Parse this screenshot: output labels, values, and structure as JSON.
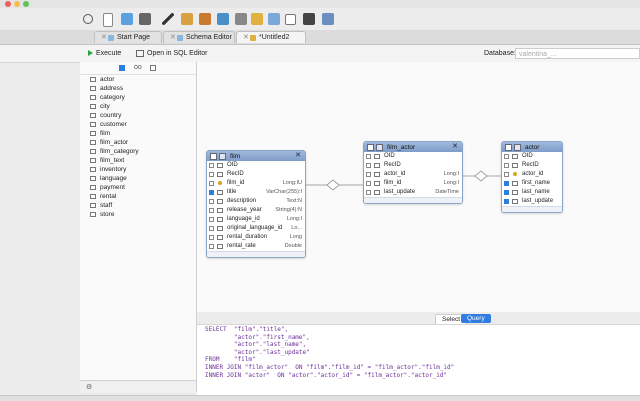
{
  "tabs": [
    {
      "label": "Start Page"
    },
    {
      "label": "Schema Editor"
    },
    {
      "label": "*Untitled2"
    }
  ],
  "actions": {
    "execute": "Execute",
    "open_sql": "Open in SQL Editor",
    "database_label": "Database:",
    "database_value": "valentina_..."
  },
  "sidebar": {
    "tables": [
      "actor",
      "address",
      "category",
      "city",
      "country",
      "customer",
      "film",
      "film_actor",
      "film_category",
      "film_text",
      "inventory",
      "language",
      "payment",
      "rental",
      "staff",
      "store"
    ]
  },
  "entities": {
    "film": {
      "title": "film",
      "close": "✕",
      "fields": [
        {
          "name": "OID",
          "type": "",
          "checked": false,
          "icon": "grid"
        },
        {
          "name": "RecID",
          "type": "",
          "checked": false,
          "icon": "grid"
        },
        {
          "name": "film_id",
          "type": "Long:IU",
          "checked": false,
          "icon": "key"
        },
        {
          "name": "title",
          "type": "VarChar(255):I",
          "checked": true,
          "icon": "col"
        },
        {
          "name": "description",
          "type": "Text:N",
          "checked": false,
          "icon": "col"
        },
        {
          "name": "release_year",
          "type": "String(4):N",
          "checked": false,
          "icon": "col"
        },
        {
          "name": "language_id",
          "type": "Long:I",
          "checked": false,
          "icon": "col"
        },
        {
          "name": "original_language_id",
          "type": "Lo...",
          "checked": false,
          "icon": "col"
        },
        {
          "name": "rental_duration",
          "type": "Long",
          "checked": false,
          "icon": "col"
        },
        {
          "name": "rental_rate",
          "type": "Double",
          "checked": false,
          "icon": "col"
        }
      ]
    },
    "film_actor": {
      "title": "film_actor",
      "close": "✕",
      "fields": [
        {
          "name": "OID",
          "type": "",
          "checked": false,
          "icon": "grid"
        },
        {
          "name": "RecID",
          "type": "",
          "checked": false,
          "icon": "grid"
        },
        {
          "name": "actor_id",
          "type": "Long:I",
          "checked": false,
          "icon": "col"
        },
        {
          "name": "film_id",
          "type": "Long:I",
          "checked": false,
          "icon": "col"
        },
        {
          "name": "last_update",
          "type": "DateTime",
          "checked": false,
          "icon": "col"
        }
      ]
    },
    "actor": {
      "title": "actor",
      "close": "",
      "fields": [
        {
          "name": "OID",
          "type": "",
          "checked": false,
          "icon": "grid"
        },
        {
          "name": "RecID",
          "type": "",
          "checked": false,
          "icon": "grid"
        },
        {
          "name": "actor_id",
          "type": "",
          "checked": false,
          "icon": "key"
        },
        {
          "name": "first_name",
          "type": "",
          "checked": true,
          "icon": "col"
        },
        {
          "name": "last_name",
          "type": "",
          "checked": true,
          "icon": "col"
        },
        {
          "name": "last_update",
          "type": "",
          "checked": true,
          "icon": "col"
        }
      ]
    }
  },
  "query_tabs": {
    "select": "Select",
    "query": "Query"
  },
  "sql_text": "SELECT  \"film\".\"title\",\n        \"actor\".\"first_name\",\n        \"actor\".\"last_name\",\n        \"actor\".\"last_update\"\nFROM    \"film\"\nINNER JOIN \"film_actor\"  ON \"film\".\"film_id\" = \"film_actor\".\"film_id\"\nINNER JOIN \"actor\"  ON \"actor\".\"actor_id\" = \"film_actor\".\"actor_id\"",
  "colors": {
    "accent": "#2f7de1",
    "entity_header": "#8fabd4",
    "sql_keyword": "#6b2f9a"
  }
}
